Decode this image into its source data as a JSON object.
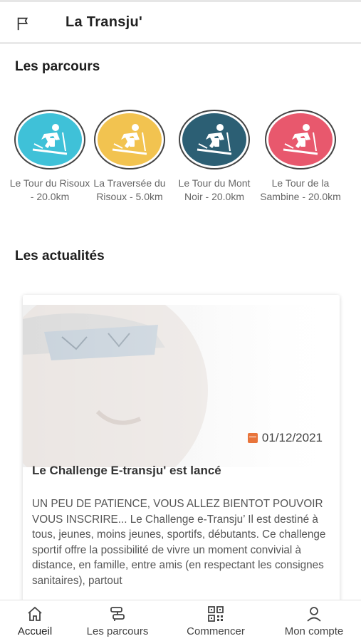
{
  "header": {
    "title": "La Transju'",
    "icon": "flag-icon"
  },
  "sections": {
    "routes_title": "Les parcours",
    "news_title": "Les actualités"
  },
  "routes": [
    {
      "label": "Le Tour du Risoux - 20.0km",
      "color": "#3fc1d8"
    },
    {
      "label": "La Traversée du Risoux - 5.0km",
      "color": "#f2c350"
    },
    {
      "label": "Le Tour du Mont Noir - 20.0km",
      "color": "#2c5f74"
    },
    {
      "label": "Le Tour de la Sambine - 20.0km",
      "color": "#e8586d"
    }
  ],
  "news": {
    "date": "01/12/2021",
    "headline": "Le Challenge E-transju' est lancé",
    "body": "UN PEU DE PATIENCE, VOUS ALLEZ BIENTOT POUVOIR VOUS INSCRIRE... Le Challenge e-Transju’ Il est destiné à tous, jeunes, moins jeunes, sportifs, débutants. Ce challenge sportif offre la possibilité de vivre un moment convivial à distance, en famille, entre amis (en respectant les consignes sanitaires), partout"
  },
  "tabs": [
    {
      "label": "Accueil",
      "icon": "home-icon",
      "active": true
    },
    {
      "label": "Les parcours",
      "icon": "route-icon",
      "active": false
    },
    {
      "label": "Commencer",
      "icon": "qr-code-icon",
      "active": false
    },
    {
      "label": "Mon compte",
      "icon": "user-icon",
      "active": false
    }
  ],
  "colors": {
    "accent": "#e8743b",
    "text": "#222222",
    "muted": "#666666"
  }
}
